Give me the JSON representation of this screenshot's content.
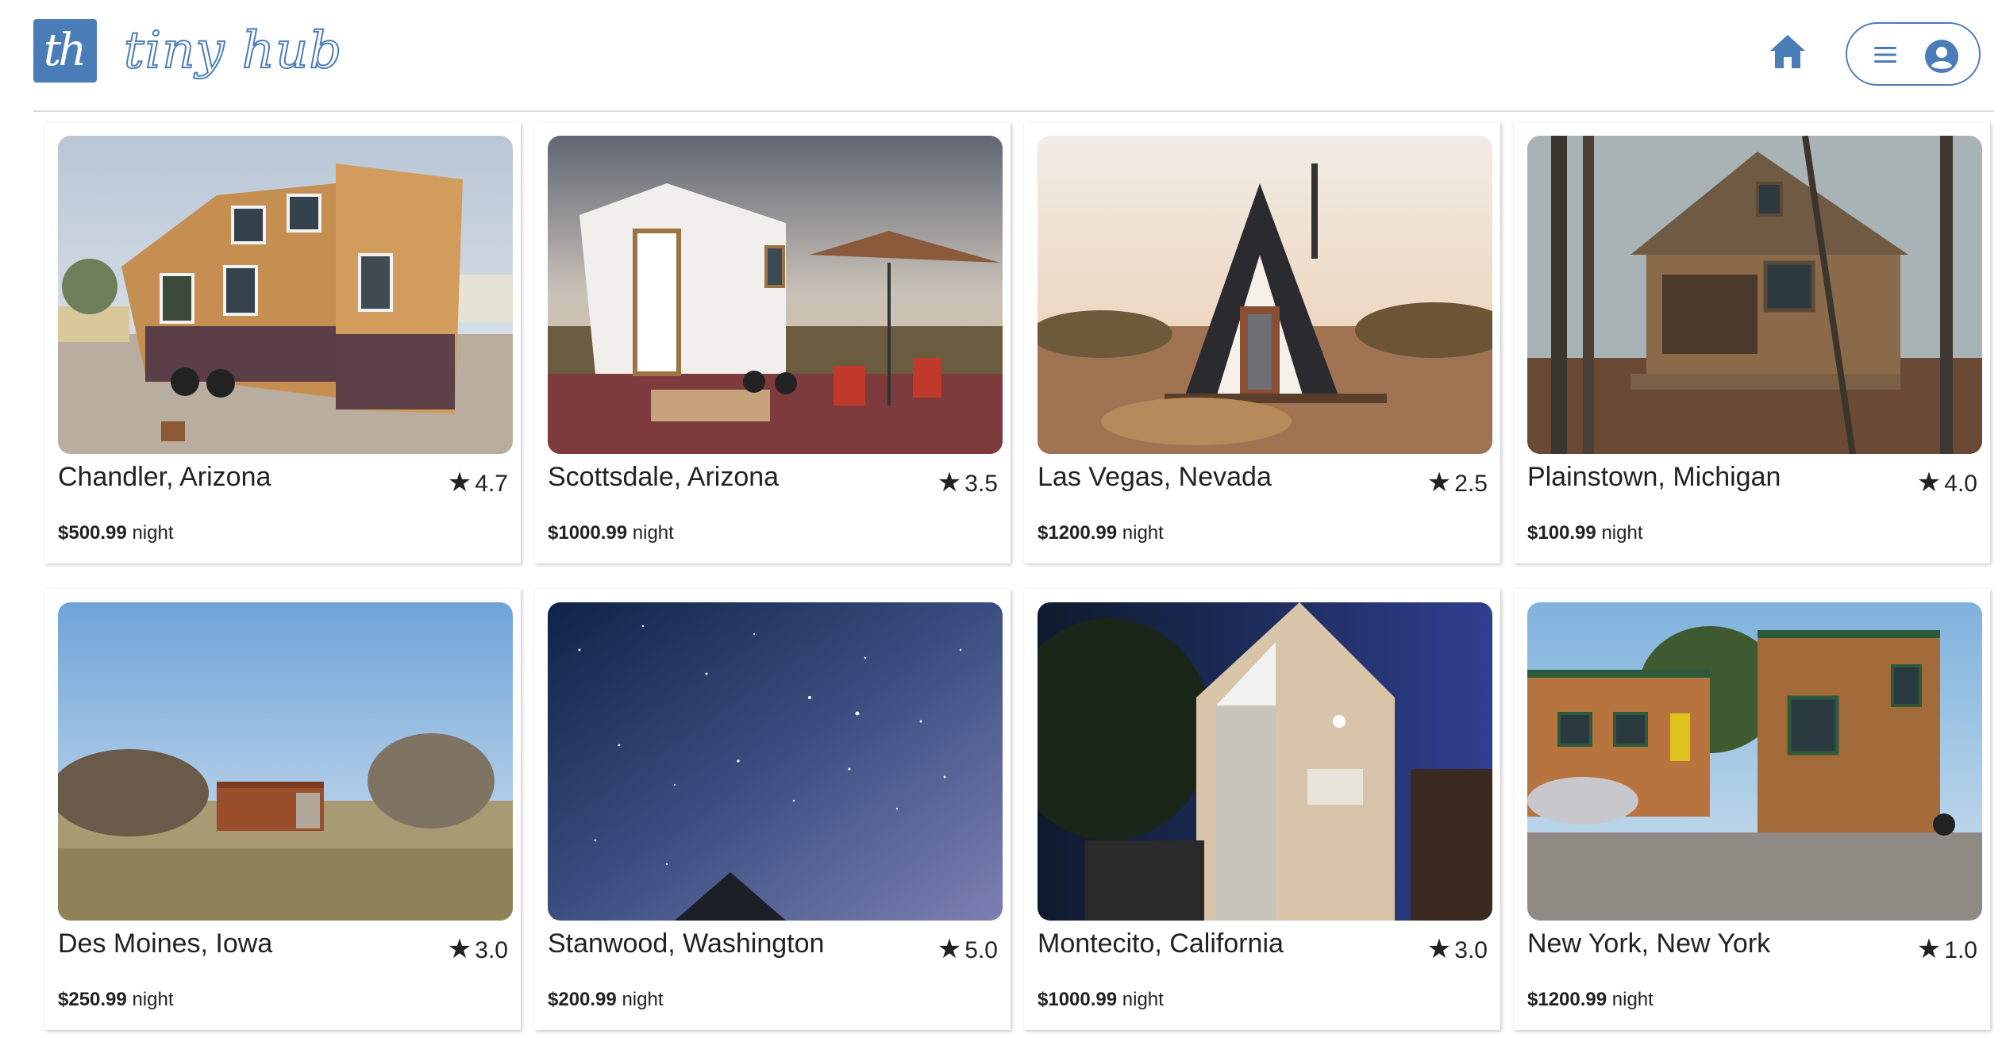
{
  "app": {
    "logo_mark": "th",
    "logo_text": "tiny hub",
    "brand_color": "#4a7db8"
  },
  "header": {
    "home_icon": "home-icon",
    "menu_icon": "hamburger-icon",
    "profile_icon": "user-circle-icon"
  },
  "listings": [
    {
      "city": "Chandler, Arizona",
      "rating": "4.7",
      "price": "$500.99",
      "unit": "night",
      "photo": "wood tiny house trailer"
    },
    {
      "city": "Scottsdale, Arizona",
      "rating": "3.5",
      "price": "$1000.99",
      "unit": "night",
      "photo": "white tiny house with umbrella"
    },
    {
      "city": "Las Vegas, Nevada",
      "rating": "2.5",
      "price": "$1200.99",
      "unit": "night",
      "photo": "a-frame cabin in desert"
    },
    {
      "city": "Plainstown, Michigan",
      "rating": "4.0",
      "price": "$100.99",
      "unit": "night",
      "photo": "wooden cabin in forest"
    },
    {
      "city": "Des Moines, Iowa",
      "rating": "3.0",
      "price": "$250.99",
      "unit": "night",
      "photo": "rust cabin in prairie"
    },
    {
      "city": "Stanwood, Washington",
      "rating": "5.0",
      "price": "$200.99",
      "unit": "night",
      "photo": "glass dome under starry sky"
    },
    {
      "city": "Montecito, California",
      "rating": "3.0",
      "price": "$1000.99",
      "unit": "night",
      "photo": "modern tiny house at night"
    },
    {
      "city": "New York, New York",
      "rating": "1.0",
      "price": "$1200.99",
      "unit": "night",
      "photo": "two wooden tiny houses"
    }
  ]
}
